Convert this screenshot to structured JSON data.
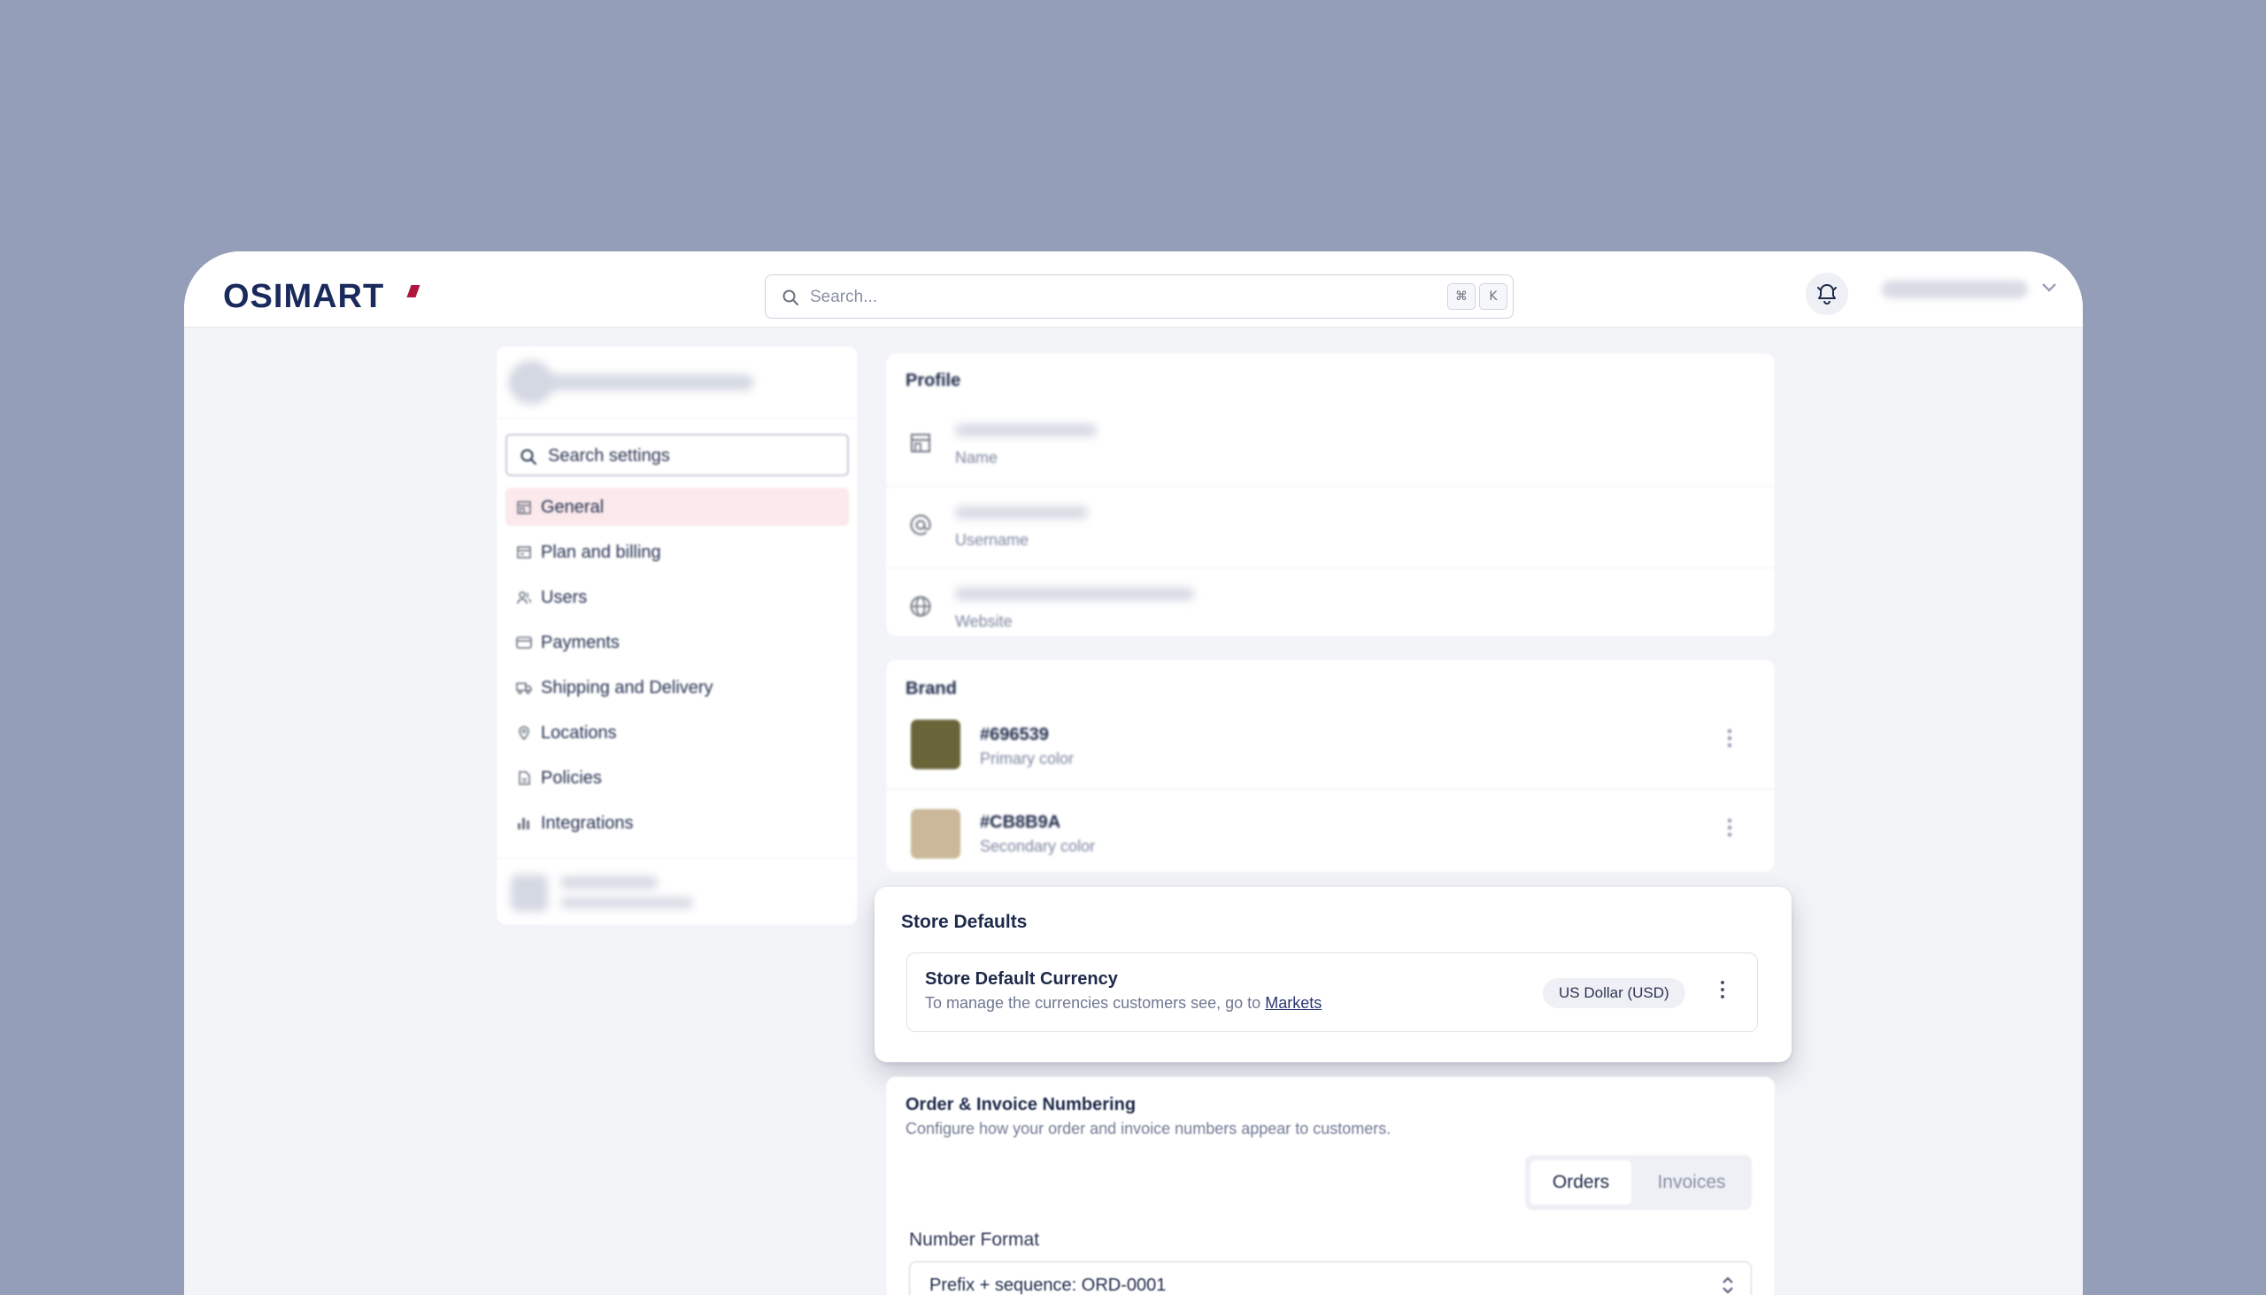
{
  "topbar": {
    "logo": "OSIMART",
    "search_placeholder": "Search...",
    "kbd_cmd": "⌘",
    "kbd_k": "K"
  },
  "sidebar": {
    "search_label": "Search settings",
    "items": [
      {
        "label": "General",
        "icon": "store-icon",
        "active": true
      },
      {
        "label": "Plan and billing",
        "icon": "billing-icon"
      },
      {
        "label": "Users",
        "icon": "users-icon"
      },
      {
        "label": "Payments",
        "icon": "card-icon"
      },
      {
        "label": "Shipping and Delivery",
        "icon": "truck-icon"
      },
      {
        "label": "Locations",
        "icon": "pin-icon"
      },
      {
        "label": "Policies",
        "icon": "document-icon"
      },
      {
        "label": "Integrations",
        "icon": "chart-icon"
      }
    ]
  },
  "profile": {
    "title": "Profile",
    "rows": [
      {
        "label": "Name",
        "icon": "store-icon"
      },
      {
        "label": "Username",
        "icon": "at-icon"
      },
      {
        "label": "Website",
        "icon": "globe-icon"
      }
    ]
  },
  "brand": {
    "title": "Brand",
    "colors": [
      {
        "hex": "#696539",
        "label": "Primary color",
        "swatch": "#696539"
      },
      {
        "hex": "#CB8B9A",
        "label": "Secondary color",
        "swatch": "#cbb89a"
      }
    ]
  },
  "store_defaults": {
    "title": "Store Defaults",
    "currency_title": "Store Default Currency",
    "currency_desc": "To manage the currencies customers see, go to",
    "currency_link": "Markets",
    "currency_value": "US Dollar (USD)"
  },
  "numbering": {
    "title": "Order & Invoice Numbering",
    "desc": "Configure how your order and invoice numbers appear to customers.",
    "tabs": [
      "Orders",
      "Invoices"
    ],
    "format_label": "Number Format",
    "format_value": "Prefix + sequence: ORD-0001"
  }
}
